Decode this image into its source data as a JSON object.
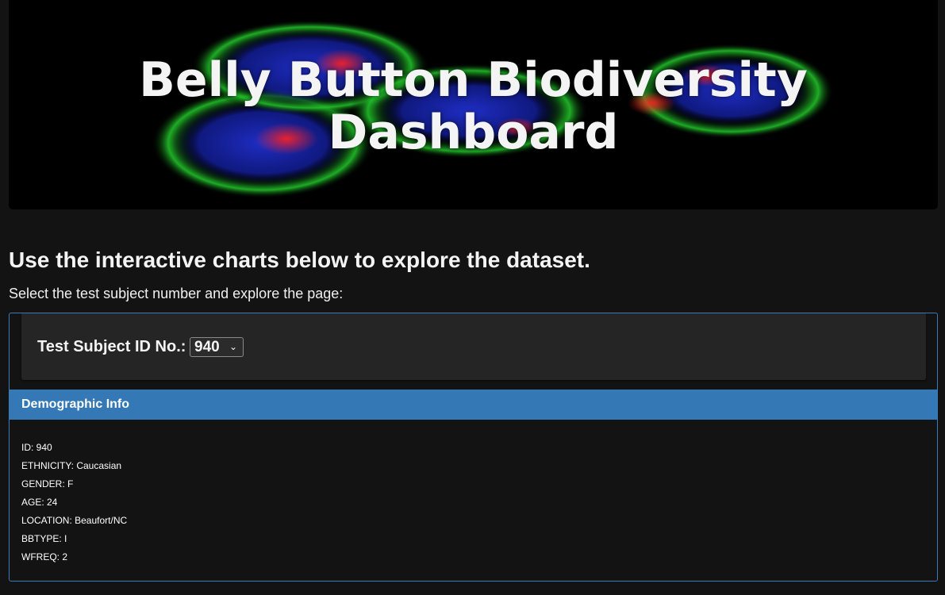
{
  "hero": {
    "title_line1": "Belly Button Biodiversity",
    "title_line2": "Dashboard"
  },
  "intro": {
    "heading": "Use the interactive charts below to explore the dataset.",
    "subheading": "Select the test subject number and explore the page:"
  },
  "selector": {
    "label": "Test Subject ID No.:",
    "selected_value": "940",
    "caret_icon": "chevron-down-icon"
  },
  "demographics": {
    "title": "Demographic Info",
    "items": [
      "ID: 940",
      "ETHNICITY: Caucasian",
      "GENDER: F",
      "AGE: 24",
      "LOCATION: Beaufort/NC",
      "BBTYPE: I",
      "WFREQ: 2"
    ]
  },
  "colors": {
    "page_background": "#131313",
    "panel_border": "#3a7ab8",
    "panel_header": "#3478b6",
    "selector_well": "#252525"
  }
}
